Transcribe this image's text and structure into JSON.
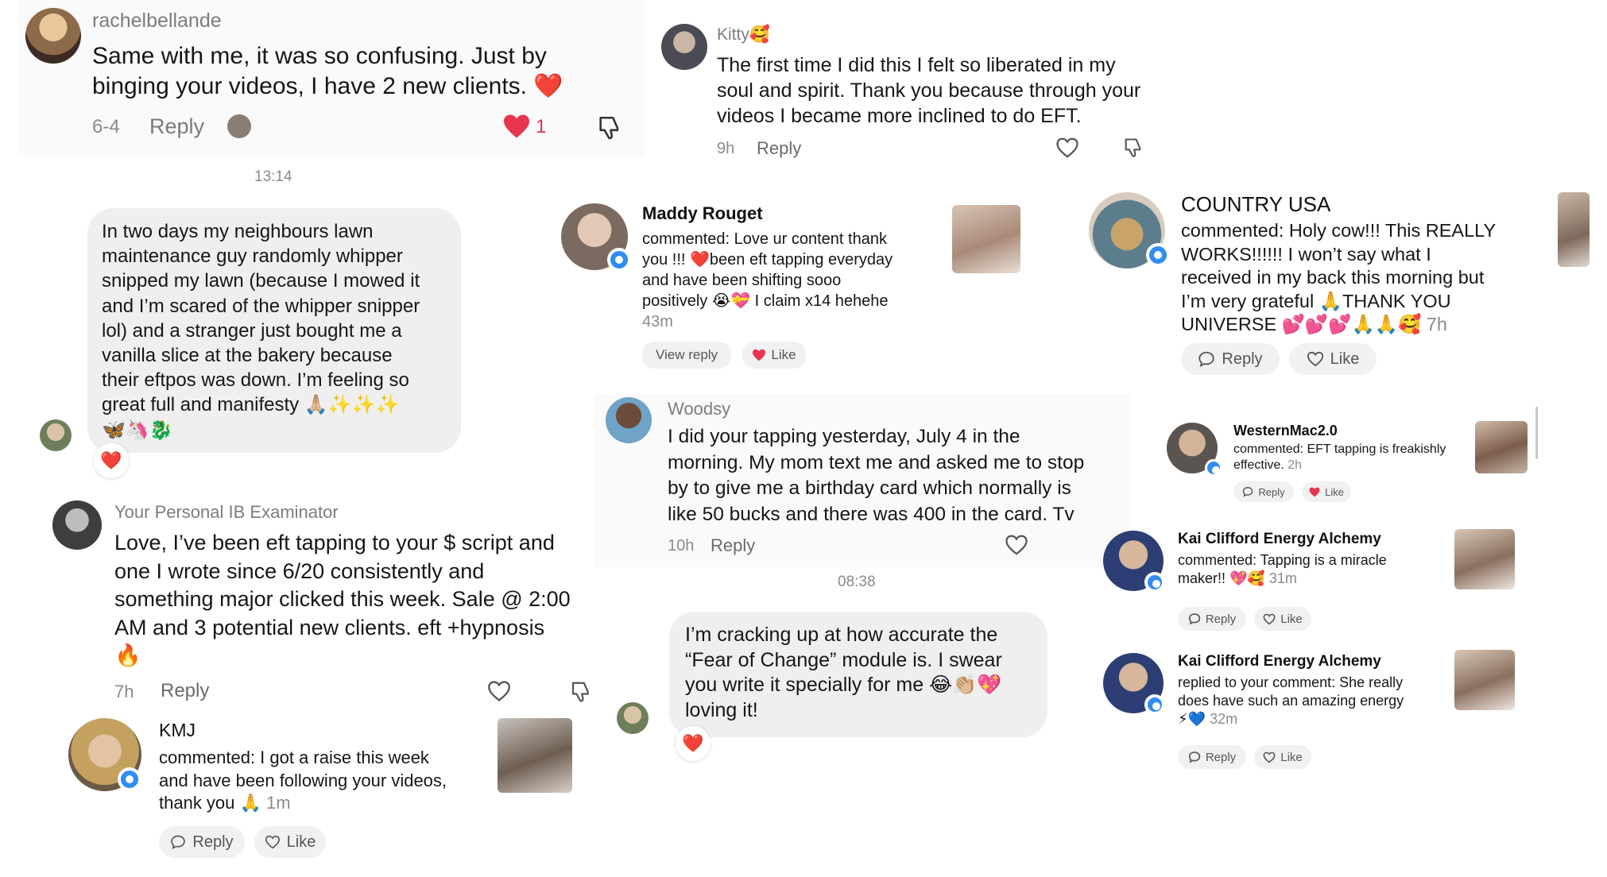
{
  "c1": {
    "username": "rachelbellande",
    "line1": "Same with me, it was so confusing. Just by",
    "line2": "binging your videos, I have 2 new clients.",
    "emoji": "❤️",
    "date": "6-4",
    "reply": "Reply",
    "likes": "1"
  },
  "c2": {
    "username": "Kitty🥰",
    "line1": "The first time I did this I felt so liberated in my",
    "line2": "soul and spirit. Thank you because through your",
    "line3": "videos I became more inclined to do EFT.",
    "time": "9h",
    "reply": "Reply"
  },
  "c3": {
    "timestamp": "13:14",
    "lines": [
      "In two days my neighbours lawn",
      "maintenance guy randomly whipper",
      "snipped my lawn (because I mowed it",
      "and I’m scared of the whipper snipper",
      "lol) and a stranger just bought me a",
      "vanilla slice at the bakery because",
      "their eftpos was down. I’m feeling so",
      "great full and manifesty 🙏🏼✨✨✨",
      "🦋🦄🐉"
    ],
    "reaction": "❤️"
  },
  "c4": {
    "username": "Maddy Rouget",
    "lines": [
      "commented: Love ur content thank",
      "you !!! ❤️been eft tapping everyday",
      "and have been shifting sooo",
      "positively 😭💝 I claim x14 hehehe"
    ],
    "time": "43m",
    "view_reply": "View reply",
    "like": "Like"
  },
  "c5": {
    "username": "COUNTRY USA",
    "lines": [
      "commented: Holy cow!!! This REALLY",
      "WORKS!!!!!! I won’t say what I",
      "received in my back this morning but",
      "I’m very grateful 🙏THANK YOU",
      "UNIVERSE 💕💕💕🙏🙏🥰"
    ],
    "time": "7h",
    "reply": "Reply",
    "like": "Like"
  },
  "c6": {
    "username": "Woodsy",
    "lines": [
      "I did your tapping yesterday, July 4 in the",
      "morning. My mom text me and asked me to stop",
      "by to give me a birthday card which normally is",
      "like 50 bucks and there was 400 in the card. Tv"
    ],
    "time": "10h",
    "reply": "Reply"
  },
  "c7": {
    "username": "WesternMac2.0",
    "line1": "commented: EFT tapping is freakishly",
    "line2": "effective.",
    "time": "2h",
    "reply": "Reply",
    "like": "Like"
  },
  "c8": {
    "username": "Your Personal IB Examinator",
    "lines": [
      "Love, I’ve been eft tapping to your $ script and",
      "one I wrote since 6/20 consistently and",
      "something major clicked this week. Sale @ 2:00",
      "AM and 3 potential new clients. eft +hypnosis",
      "🔥"
    ],
    "time": "7h",
    "reply": "Reply"
  },
  "c9": {
    "username": "Kai Clifford Energy Alchemy",
    "line1": "commented: Tapping is a miracle",
    "line2": "maker!! 💖🥰",
    "time": "31m",
    "reply": "Reply",
    "like": "Like"
  },
  "c10": {
    "timestamp": "08:38",
    "lines": [
      "I’m cracking up at how accurate the",
      "“Fear of Change” module is. I swear",
      "you write it specially for me 😂👏🏼💖",
      "loving it!"
    ],
    "reaction": "❤️"
  },
  "c11": {
    "username": "Kai Clifford Energy Alchemy",
    "line1": "replied to your comment: She really",
    "line2": "does have such an amazing energy",
    "line3": "⚡💙",
    "time": "32m",
    "reply": "Reply",
    "like": "Like"
  },
  "c12": {
    "username": "KMJ",
    "line1": "commented: I got a raise this week",
    "line2": "and have been following your videos,",
    "line3": "thank you 🙏",
    "time": "1m",
    "reply": "Reply",
    "like": "Like"
  },
  "colors": {
    "badge": "#2f8cf0",
    "heart": "#e8344e",
    "bubble": "#efefef",
    "muted": "#8a8a8a"
  }
}
